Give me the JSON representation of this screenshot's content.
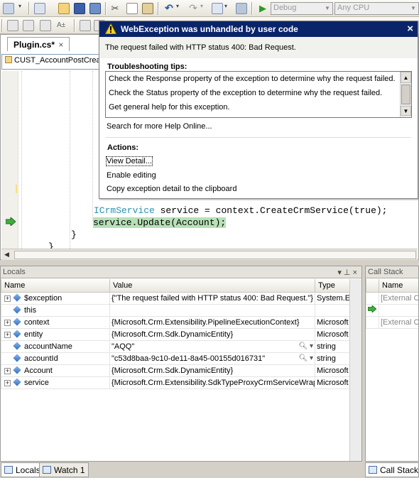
{
  "toolbar": {
    "config_combo": "Debug",
    "platform_combo": "Any CPU"
  },
  "editor": {
    "tab_title": "Plugin.cs*",
    "tab_close": "×",
    "nav_dropdown": "CUST_AccountPostCrea",
    "lines": {
      "service_decl_type": "ICrmService",
      "service_decl_rest": " service = context.CreateCrmService(true);",
      "update_call": "service.Update(Account);",
      "brace1": "}",
      "brace2": "}"
    }
  },
  "exception_helper": {
    "title": "WebException was unhandled by user code",
    "close": "×",
    "message": "The request failed with HTTP status 400: Bad Request.",
    "troubleshooting_heading": "Troubleshooting tips:",
    "tips": [
      "Check the Response property of the exception to determine why the request failed.",
      "Check the Status property of the exception to determine why the request failed.",
      "Get general help for this exception."
    ],
    "search_link": "Search for more Help Online...",
    "actions_heading": "Actions:",
    "actions": [
      "View Detail...",
      "Enable editing",
      "Copy exception detail to the clipboard"
    ]
  },
  "locals": {
    "title": "Locals",
    "title_controls": "▾ ⊥ ×",
    "columns": [
      "Name",
      "Value",
      "Type"
    ],
    "rows": [
      {
        "name": "$exception",
        "value": "{\"The request failed with HTTP status 400: Bad Request.\"}",
        "type": "System.E"
      },
      {
        "name": "this",
        "value": "",
        "type": ""
      },
      {
        "name": "context",
        "value": "{Microsoft.Crm.Extensibility.PipelineExecutionContext}",
        "type": "Microsoft"
      },
      {
        "name": "entity",
        "value": "{Microsoft.Crm.Sdk.DynamicEntity}",
        "type": "Microsoft"
      },
      {
        "name": "accountName",
        "value": "\"AQQ\"",
        "type": "string"
      },
      {
        "name": "accountId",
        "value": "\"c53d8baa-9c10-de11-8a45-00155d016731\"",
        "type": "string"
      },
      {
        "name": "Account",
        "value": "{Microsoft.Crm.Sdk.DynamicEntity}",
        "type": "Microsoft"
      },
      {
        "name": "service",
        "value": "{Microsoft.Crm.Extensibility.SdkTypeProxyCrmServiceWrap",
        "type": "Microsoft"
      }
    ]
  },
  "callstack": {
    "title": "Call Stack",
    "column": "Name",
    "rows": [
      "[External Co",
      "",
      "[External Co"
    ]
  },
  "bottom_tabs": {
    "locals": "Locals",
    "watch": "Watch 1",
    "callstack": "Call Stack"
  }
}
